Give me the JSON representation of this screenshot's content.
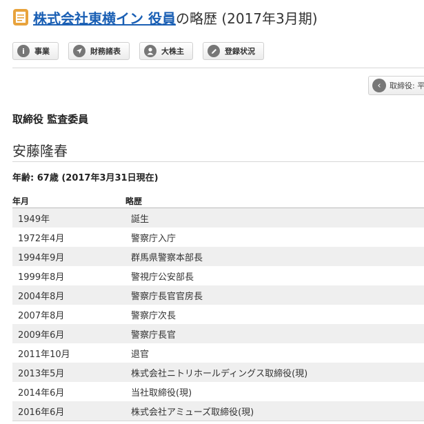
{
  "header": {
    "company_link": "株式会社東横イン 役員",
    "title_suffix": "の略歴 (2017年3月期)"
  },
  "toolbar": {
    "business": {
      "label": "事業",
      "icon": "info-icon"
    },
    "finance": {
      "label": "財務諸表",
      "icon": "navigation-arrow-icon"
    },
    "shareholders": {
      "label": "大株主",
      "icon": "person-icon"
    },
    "registry": {
      "label": "登録状況",
      "icon": "pencil-icon"
    }
  },
  "back_button": {
    "label": "取締役: 平",
    "icon": "chevron-left-icon"
  },
  "officer": {
    "position": "取締役 監査委員",
    "name": "安藤隆春",
    "age_line": "年齢: 67歳 (2017年3月31日現在)"
  },
  "history": {
    "headers": [
      "年月",
      "略歴"
    ],
    "rows": [
      {
        "date": "1949年",
        "event": "誕生"
      },
      {
        "date": "1972年4月",
        "event": "警察庁入庁"
      },
      {
        "date": "1994年9月",
        "event": "群馬県警察本部長"
      },
      {
        "date": "1999年8月",
        "event": "警視庁公安部長"
      },
      {
        "date": "2004年8月",
        "event": "警察庁長官官房長"
      },
      {
        "date": "2007年8月",
        "event": "警察庁次長"
      },
      {
        "date": "2009年6月",
        "event": "警察庁長官"
      },
      {
        "date": "2011年10月",
        "event": "退官"
      },
      {
        "date": "2013年5月",
        "event": "株式会社ニトリホールディングス取締役(現)"
      },
      {
        "date": "2014年6月",
        "event": "当社取締役(現)"
      },
      {
        "date": "2016年6月",
        "event": "株式会社アミューズ取締役(現)"
      }
    ]
  },
  "colors": {
    "link": "#1a5fb4",
    "icon_gray": "#777777",
    "row_stripe": "#efefef",
    "doc_icon": "#e8a33c"
  }
}
